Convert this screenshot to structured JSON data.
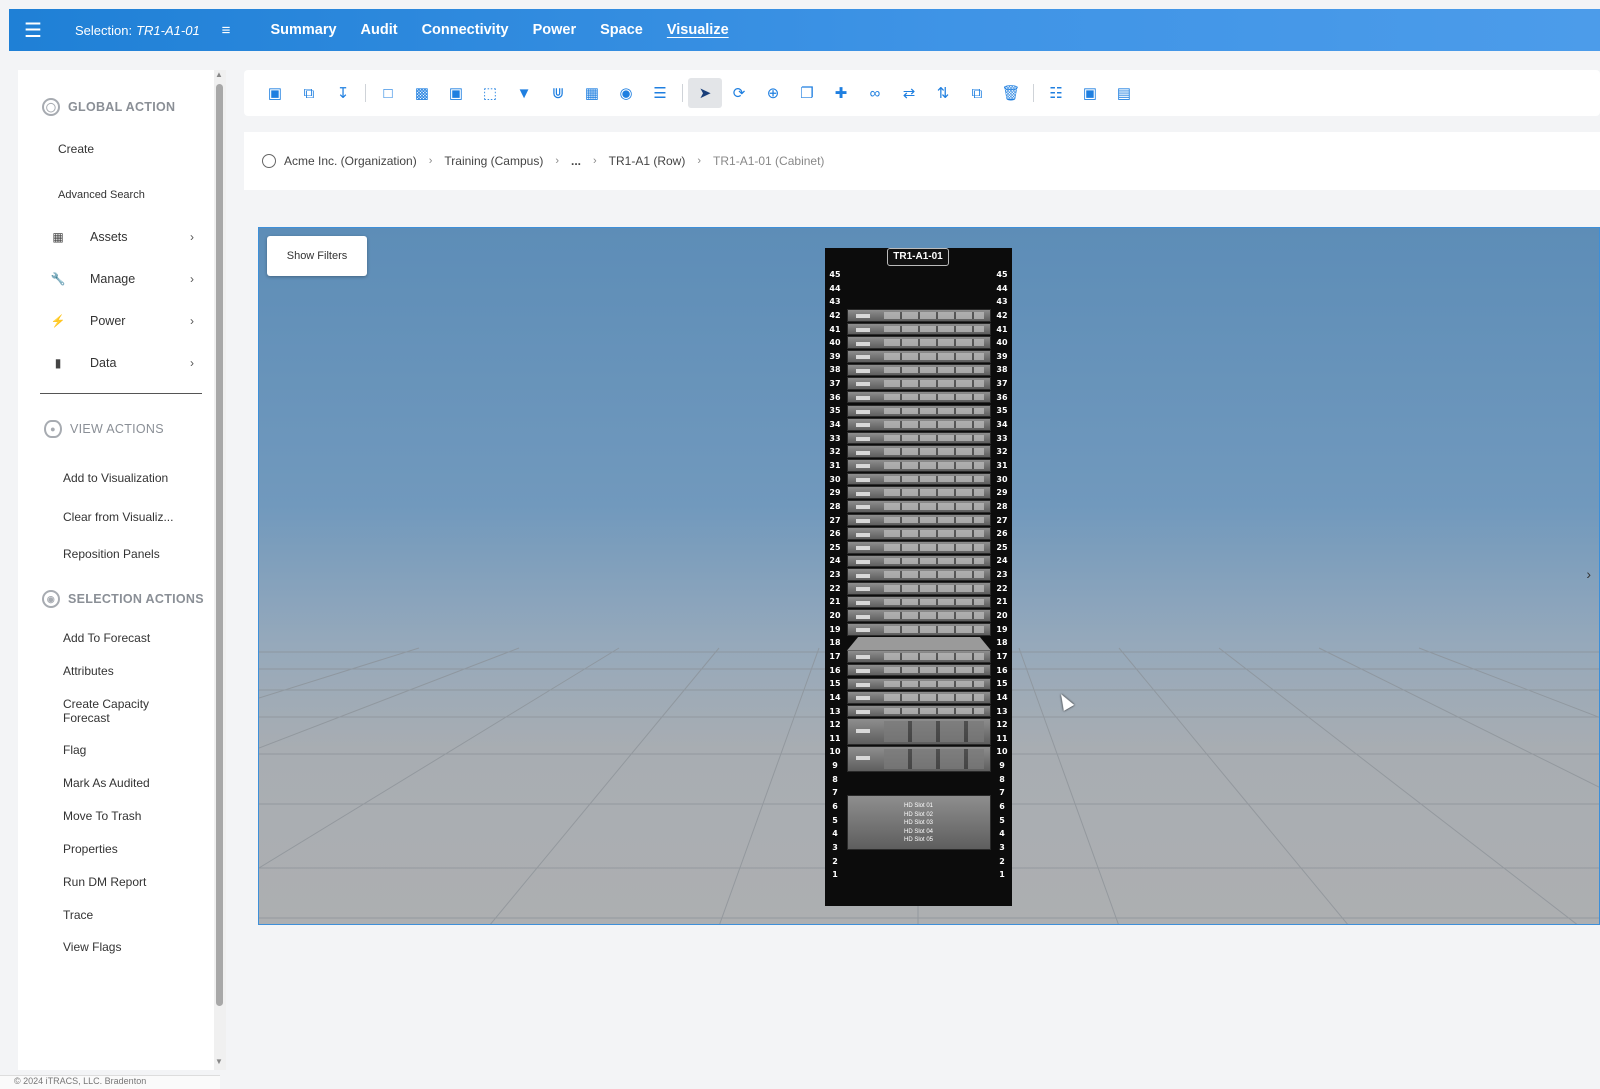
{
  "topbar": {
    "selection_label": "Selection:",
    "selection_value": "TR1-A1-01",
    "tabs": [
      {
        "label": "Summary"
      },
      {
        "label": "Audit"
      },
      {
        "label": "Connectivity"
      },
      {
        "label": "Power"
      },
      {
        "label": "Space"
      },
      {
        "label": "Visualize",
        "active": true
      }
    ]
  },
  "sidebar": {
    "global_action": {
      "title": "GLOBAL ACTION",
      "items": [
        "Create",
        "Advanced Search"
      ],
      "groups": [
        {
          "label": "Assets",
          "icon": "grid-icon"
        },
        {
          "label": "Manage",
          "icon": "wrench-icon"
        },
        {
          "label": "Power",
          "icon": "bolt-icon"
        },
        {
          "label": "Data",
          "icon": "bar-chart-icon"
        }
      ]
    },
    "view_actions": {
      "title": "VIEW ACTIONS",
      "items": [
        "Add to Visualization",
        "Clear from Visualiz...",
        "Reposition Panels"
      ]
    },
    "selection_actions": {
      "title": "SELECTION ACTIONS",
      "items": [
        "Add To Forecast",
        "Attributes",
        "Create Capacity Forecast",
        "Flag",
        "Mark As Audited",
        "Move To Trash",
        "Properties",
        "Run DM Report",
        "Trace",
        "View Flags"
      ]
    },
    "footer": "© 2024 iTRACS, LLC. Bradenton"
  },
  "breadcrumb": [
    "Acme Inc. (Organization)",
    "Training (Campus)",
    "...",
    "TR1-A1 (Row)",
    "TR1-A1-01 (Cabinet)"
  ],
  "viewport": {
    "show_filters_label": "Show Filters",
    "rack": {
      "title": "TR1-A1-01",
      "units": 45,
      "chassis_slots": [
        "HD Slot 01",
        "HD Slot 02",
        "HD Slot 03",
        "HD Slot 04",
        "HD Slot 05"
      ]
    }
  },
  "colors": {
    "topbar": "#2b88dd",
    "accent": "#1f7fe0"
  }
}
